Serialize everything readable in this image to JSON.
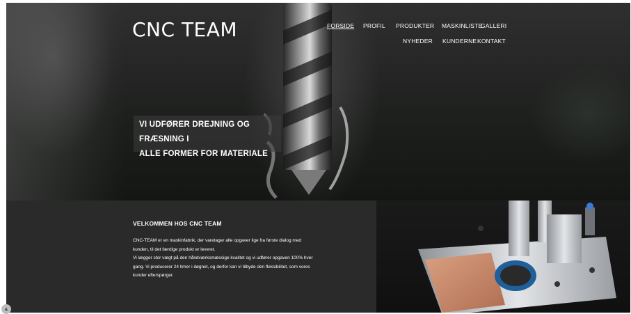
{
  "header": {
    "logo": "CNC TEAM",
    "nav": [
      {
        "label": "FORSIDE",
        "active": true
      },
      {
        "label": "PROFIL"
      },
      {
        "label": "PRODUKTER"
      },
      {
        "label": "MASKINLISTE"
      },
      {
        "label": "GALLERI"
      },
      {
        "label": "NYHEDER"
      },
      {
        "label": "KUNDERNE"
      },
      {
        "label": "KONTAKT"
      }
    ]
  },
  "hero": {
    "tagline_line1": "VI UDFØRER DREJNING OG FRÆSNING I",
    "tagline_line2": "ALLE FORMER FOR MATERIALE"
  },
  "welcome": {
    "heading": "VELKOMMEN HOS CNC TEAM",
    "lines": [
      "CNC-TEAM er en maskinfabrik, der varetager alle opgaver lige fra første dialog med",
      "kunden, til det færdige produkt er leveret.",
      "Vi lægger stor vægt på den håndværksmæssige kvalitet og vi udfører opgaven 100% hver",
      "gang. Vi producerer 24 timer i døgnet, og derfor kan vi tilbyde den fleksibilitet, som vores",
      "kunder efterspørger."
    ]
  },
  "colors": {
    "hero_bg": "#1d1f1d",
    "welcome_bg": "#2a2a2a",
    "text": "#ffffff",
    "copper": "#c98a6a",
    "seal_blue": "#1f5f9a"
  },
  "icons": {
    "scroll_button": "chevron-up-icon"
  }
}
